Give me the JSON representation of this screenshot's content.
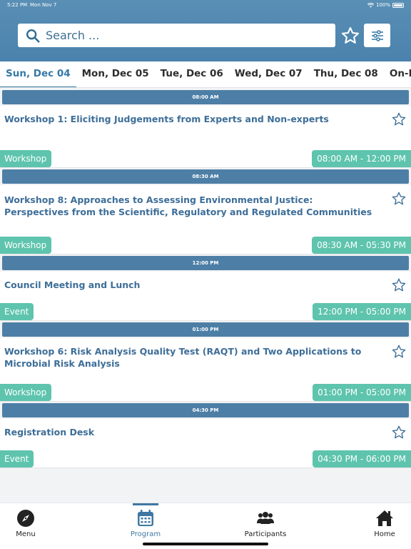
{
  "status_bar": {
    "time": "5:22 PM",
    "date": "Mon Nov 7",
    "battery": "100%"
  },
  "search": {
    "placeholder": "Search ..."
  },
  "tabs": [
    {
      "label": "Sun, Dec 04",
      "active": true
    },
    {
      "label": "Mon, Dec 05"
    },
    {
      "label": "Tue, Dec 06"
    },
    {
      "label": "Wed, Dec 07"
    },
    {
      "label": "Thu, Dec 08"
    },
    {
      "label": "On-Demand"
    }
  ],
  "sessions": [
    {
      "time_header": "08:00 AM",
      "title": "Workshop 1: Eliciting Judgements from Experts and Non-experts",
      "type": "Workshop",
      "time_range": "08:00 AM - 12:00 PM"
    },
    {
      "time_header": "08:30 AM",
      "title": "Workshop 8: Approaches to Assessing Environmental Justice: Perspectives from the Scientific, Regulatory and Regulated Communities",
      "type": "Workshop",
      "time_range": "08:30 AM - 05:30 PM"
    },
    {
      "time_header": "12:00 PM",
      "title": "Council Meeting and Lunch",
      "type": "Event",
      "time_range": "12:00 PM - 05:00 PM"
    },
    {
      "time_header": "01:00 PM",
      "title": "Workshop 6: Risk Analysis Quality Test (RAQT) and Two Applications to Microbial Risk Analysis",
      "type": "Workshop",
      "time_range": "01:00 PM - 05:00 PM"
    },
    {
      "time_header": "04:30 PM",
      "title": "Registration Desk",
      "type": "Event",
      "time_range": "04:30 PM - 06:00 PM"
    }
  ],
  "bottom_nav": [
    {
      "label": "Menu",
      "icon": "compass-icon"
    },
    {
      "label": "Program",
      "icon": "calendar-icon",
      "active": true
    },
    {
      "label": "Participants",
      "icon": "users-icon"
    },
    {
      "label": "Home",
      "icon": "home-icon"
    }
  ],
  "colors": {
    "header": "#4a82ad",
    "accent": "#3579a6",
    "badge": "#5ec4ad",
    "time_bar": "#4d7fa6"
  }
}
